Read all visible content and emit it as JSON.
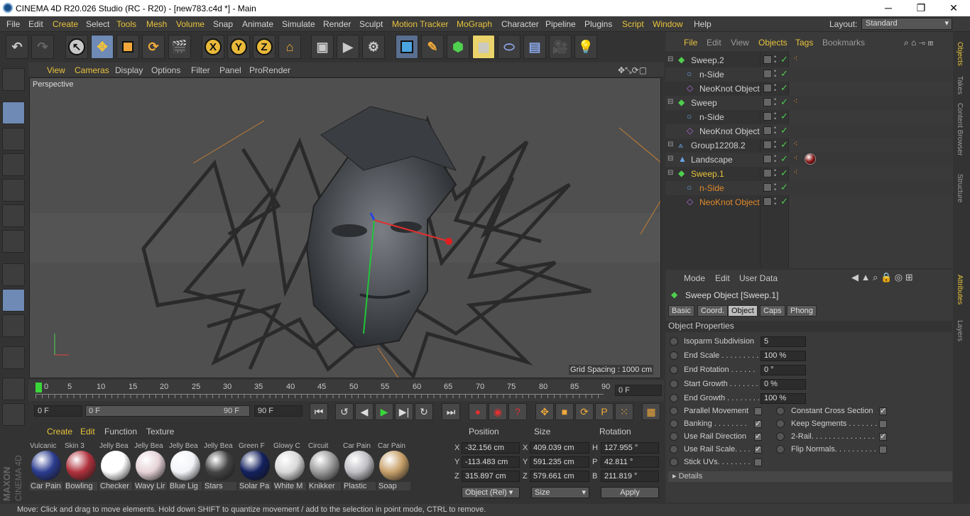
{
  "window": {
    "title": "CINEMA 4D R20.026 Studio (RC - R20) - [new783.c4d *] - Main"
  },
  "menubar": {
    "items": [
      "File",
      "Edit",
      "Create",
      "Select",
      "Tools",
      "Mesh",
      "Volume",
      "Snap",
      "Animate",
      "Simulate",
      "Render",
      "Sculpt",
      "Motion Tracker",
      "MoGraph",
      "Character",
      "Pipeline",
      "Plugins",
      "Script",
      "Window",
      "Help"
    ],
    "layout_label": "Layout:",
    "layout_value": "Standard"
  },
  "toolbar": {
    "axis_x": "X",
    "axis_y": "Y",
    "axis_z": "Z"
  },
  "viewport": {
    "menu": [
      "View",
      "Cameras",
      "Display",
      "Options",
      "Filter",
      "Panel",
      "ProRender"
    ],
    "camera": "Perspective",
    "grid_spacing": "Grid Spacing : 1000 cm"
  },
  "timeline": {
    "ticks": [
      "0",
      "5",
      "10",
      "15",
      "20",
      "25",
      "30",
      "35",
      "40",
      "45",
      "50",
      "55",
      "60",
      "65",
      "70",
      "75",
      "80",
      "85",
      "90"
    ],
    "current_frame": "0 F",
    "start": "0 F",
    "range_start": "0 F",
    "range_end": "90 F",
    "end": "90 F"
  },
  "materials": {
    "menu": [
      "Create",
      "Edit",
      "Function",
      "Texture"
    ],
    "items": [
      {
        "top": "Vulcanic",
        "label": "Car Pain",
        "color": "#2b3c8f"
      },
      {
        "top": "Skin 3",
        "label": "Bowling",
        "color": "#b0323d"
      },
      {
        "top": "Jelly Bea",
        "label": "Checker",
        "color": "#ffffff"
      },
      {
        "top": "Jelly Bea",
        "label": "Wavy Lir",
        "color": "#e6d3d8"
      },
      {
        "top": "Jelly Bea",
        "label": "Blue Lig",
        "color": "#f2f4f8"
      },
      {
        "top": "Jelly Bea",
        "label": "Stars",
        "color": "#444444"
      },
      {
        "top": "Green F",
        "label": "Solar Pa",
        "color": "#13215e"
      },
      {
        "top": "Glowy C",
        "label": "White M",
        "color": "#d8d8d8"
      },
      {
        "top": "Circuit",
        "label": "Knikker",
        "color": "#9a9a9a"
      },
      {
        "top": "Car Pain",
        "label": "Plastic",
        "color": "#bfbfc4"
      },
      {
        "top": "Car Pain",
        "label": "Soap",
        "color": "#c7a06a"
      }
    ]
  },
  "coordinates": {
    "headers": [
      "Position",
      "Size",
      "Rotation"
    ],
    "rows": [
      {
        "axis": "X",
        "pos": "-32.156 cm",
        "saxis": "X",
        "size": "409.039 cm",
        "raxis": "H",
        "rot": "127.955 °"
      },
      {
        "axis": "Y",
        "pos": "-113.483 cm",
        "saxis": "Y",
        "size": "591.235 cm",
        "raxis": "P",
        "rot": "42.811 °"
      },
      {
        "axis": "Z",
        "pos": "315.897 cm",
        "saxis": "Z",
        "size": "579.661 cm",
        "raxis": "B",
        "rot": "211.819 °"
      }
    ],
    "mode": "Object (Rel)",
    "size_mode": "Size",
    "apply": "Apply"
  },
  "objects": {
    "menu": [
      "File",
      "Edit",
      "View",
      "Objects",
      "Tags",
      "Bookmarks"
    ],
    "rows": [
      {
        "name": "Sweep.2",
        "indent": 0,
        "type": "sweep",
        "hl": false
      },
      {
        "name": "n-Side",
        "indent": 1,
        "type": "nside",
        "hl": false
      },
      {
        "name": "NeoKnot Object",
        "indent": 1,
        "type": "knot",
        "hl": false
      },
      {
        "name": "Sweep",
        "indent": 0,
        "type": "sweep",
        "hl": false
      },
      {
        "name": "n-Side",
        "indent": 1,
        "type": "nside",
        "hl": false
      },
      {
        "name": "NeoKnot Object",
        "indent": 1,
        "type": "knot",
        "hl": false
      },
      {
        "name": "Group12208.2",
        "indent": 0,
        "type": "null",
        "hl": false
      },
      {
        "name": "Landscape",
        "indent": 0,
        "type": "landscape",
        "hl": false
      },
      {
        "name": "Sweep.1",
        "indent": 0,
        "type": "sweep",
        "hl": true
      },
      {
        "name": "n-Side",
        "indent": 1,
        "type": "nside",
        "hl": true
      },
      {
        "name": "NeoKnot Object",
        "indent": 1,
        "type": "knot",
        "hl": true
      }
    ]
  },
  "attributes": {
    "menu": [
      "Mode",
      "Edit",
      "User Data"
    ],
    "title": "Sweep Object [Sweep.1]",
    "tabs": [
      "Basic",
      "Coord.",
      "Object",
      "Caps",
      "Phong"
    ],
    "section": "Object Properties",
    "fields": [
      {
        "label": "Isoparm Subdivision",
        "value": "5"
      },
      {
        "label": "End Scale . . . . . . . . . .",
        "value": "100 %"
      },
      {
        "label": "End Rotation . . . . . .",
        "value": "0 °"
      },
      {
        "label": "Start Growth . . . . . . .",
        "value": "0 %"
      },
      {
        "label": "End Growth . . . . . . . .",
        "value": "100 %"
      }
    ],
    "left_checks": [
      {
        "label": "Parallel Movement",
        "checked": false
      },
      {
        "label": "Banking . . . . . . . .",
        "checked": true
      },
      {
        "label": "Use Rail Direction",
        "checked": true
      },
      {
        "label": "Use Rail Scale. . . .",
        "checked": true
      },
      {
        "label": "Stick UVs. . . . . . . .",
        "checked": false
      }
    ],
    "right_checks": [
      {
        "label": "Constant Cross Section",
        "checked": true
      },
      {
        "label": "Keep Segments . . . . . . .",
        "checked": false
      },
      {
        "label": "2-Rail. . . . . . . . . . . . . . .",
        "checked": true
      },
      {
        "label": "Flip Normals. . . . . . . . . .",
        "checked": false
      }
    ],
    "details": "Details"
  },
  "sidetabs": [
    "Objects",
    "Takes",
    "Content Browser",
    "Structure",
    "Attributes",
    "Layers"
  ],
  "status": "Move: Click and drag to move elements. Hold down SHIFT to quantize movement / add to the selection in point mode, CTRL to remove.",
  "colors": {
    "accent": "#e8c33c",
    "selected_tab": "#6e8ab5",
    "orange": "#e08a2c"
  }
}
